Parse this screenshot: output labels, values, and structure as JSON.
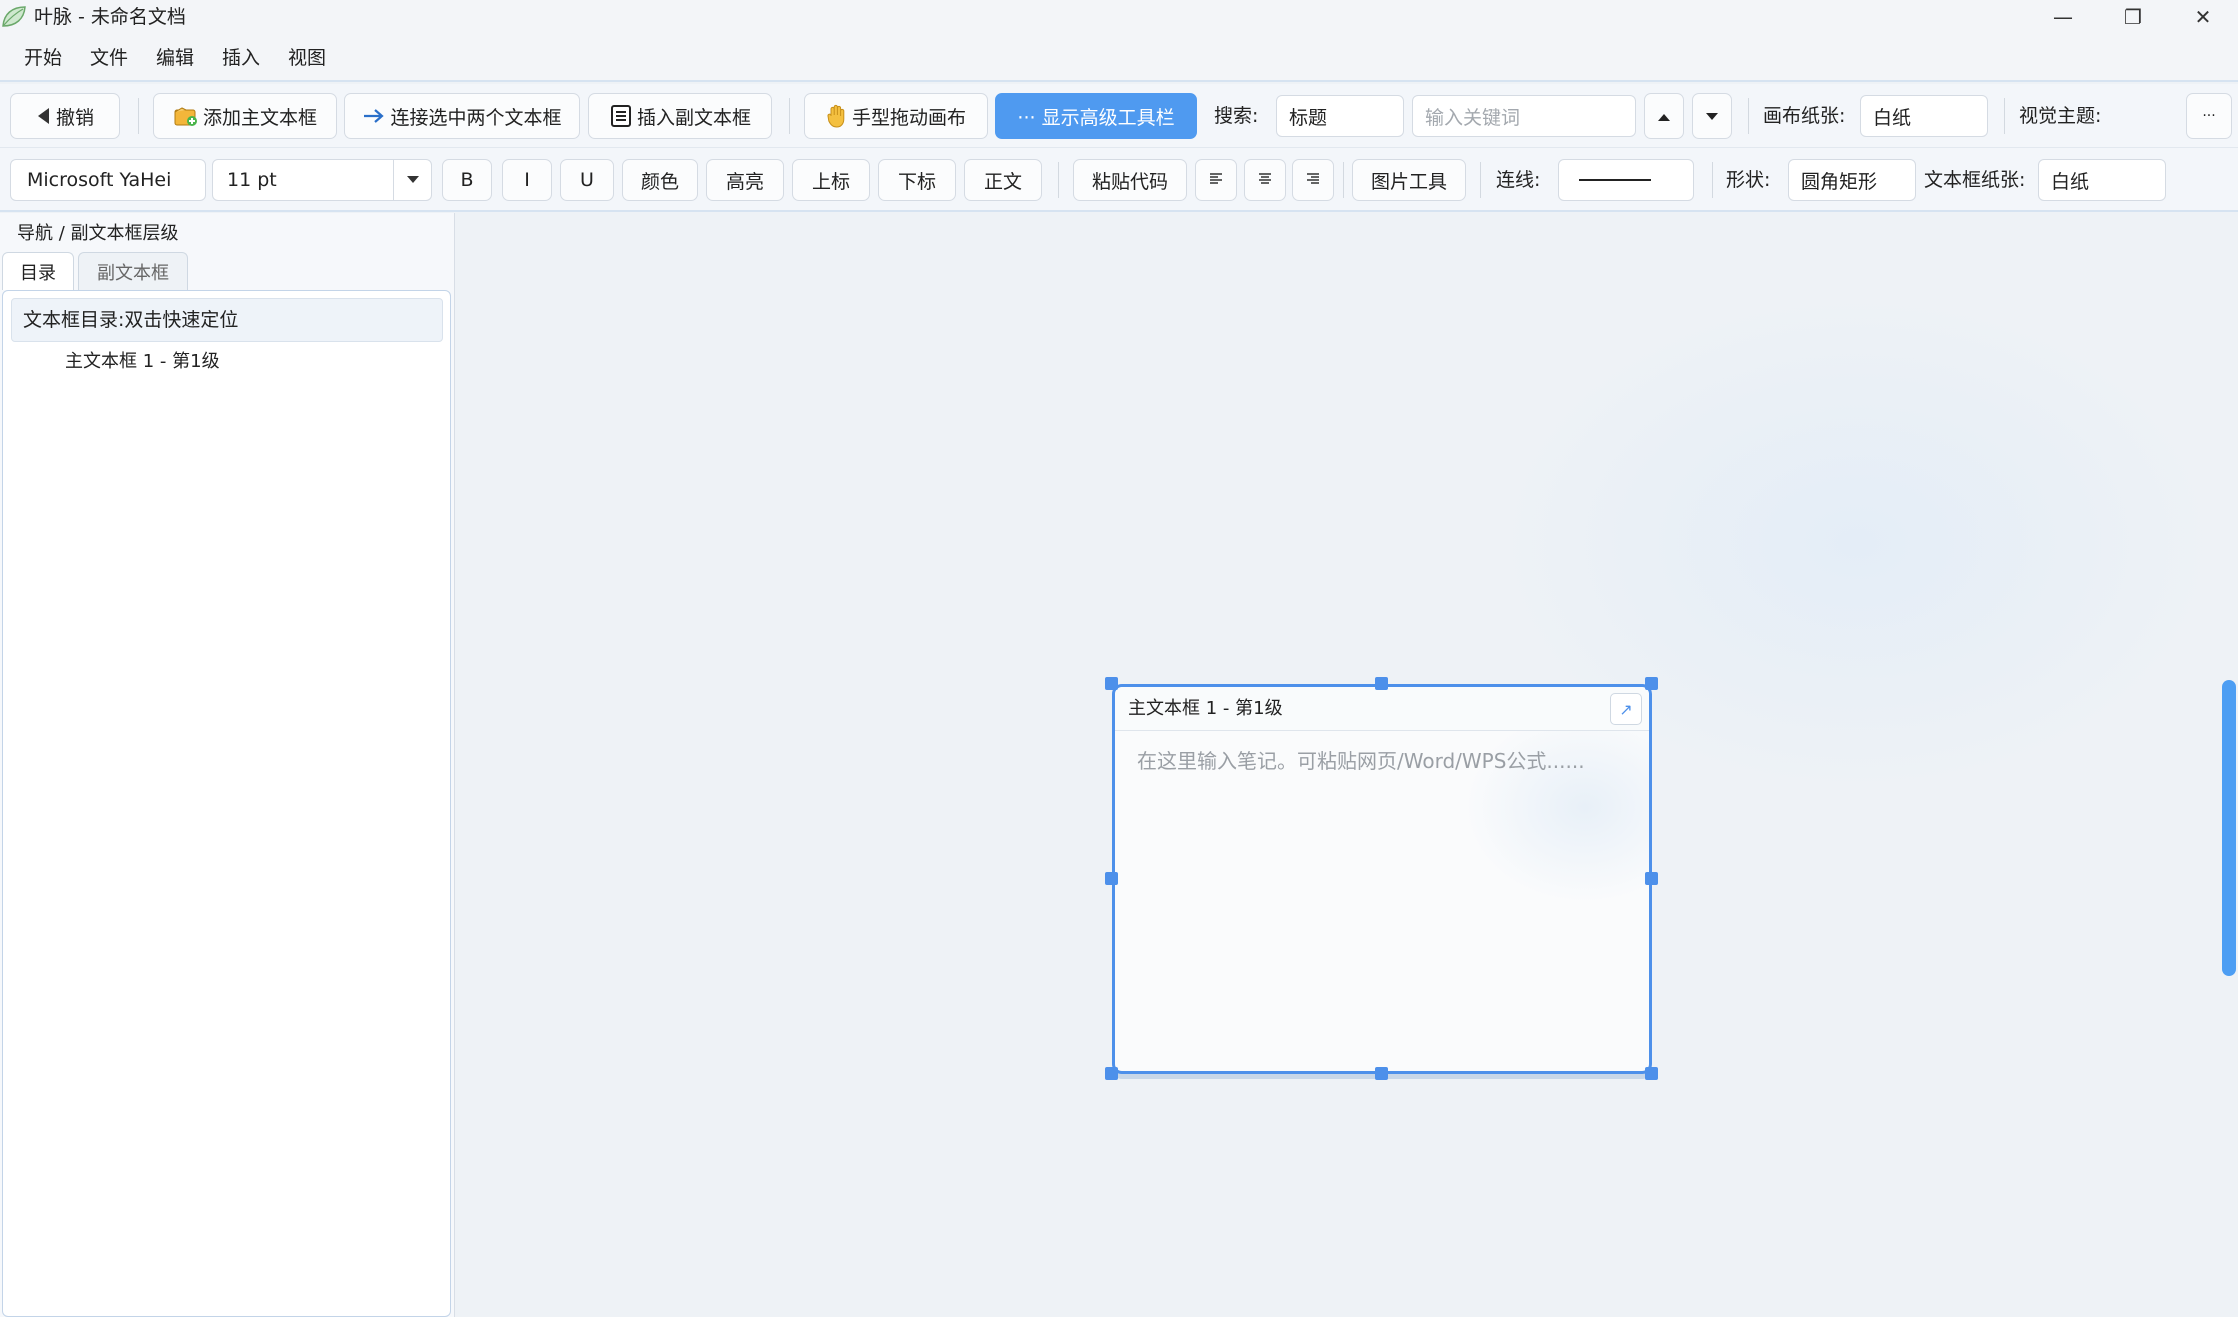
{
  "window": {
    "title": "叶脉 - 未命名文档",
    "minimize_label": "—",
    "restore_label": "❐",
    "close_label": "✕"
  },
  "menu": [
    "开始",
    "文件",
    "编辑",
    "插入",
    "视图"
  ],
  "toolbar1": {
    "undo": "撤销",
    "add_main_box": "添加主文本框",
    "connect_boxes": "连接选中两个文本框",
    "insert_sub_box": "插入副文本框",
    "hand_drag": "手型拖动画布",
    "show_advanced": "··· 显示高级工具栏",
    "search_label": "搜索:",
    "search_scope": "标题",
    "search_placeholder": "输入关键词",
    "canvas_paper_label": "画布纸张:",
    "canvas_paper_value": "白纸",
    "visual_theme_label": "视觉主题:",
    "more_label": "···"
  },
  "toolbar2": {
    "font_family": "Microsoft YaHei",
    "font_size": "11 pt",
    "bold": "B",
    "italic": "I",
    "underline": "U",
    "color": "颜色",
    "highlight": "高亮",
    "superscript": "上标",
    "subscript": "下标",
    "body_text": "正文",
    "paste_code": "粘贴代码",
    "image_tools": "图片工具",
    "line_label": "连线:",
    "shape_label": "形状:",
    "shape_value": "圆角矩形",
    "box_paper_label": "文本框纸张:",
    "box_paper_value": "白纸"
  },
  "left_panel": {
    "title": "导航 / 副文本框层级",
    "tabs": [
      "目录",
      "副文本框"
    ],
    "tree_header": "文本框目录:双击快速定位",
    "items": [
      "主文本框 1 - 第1级"
    ]
  },
  "note": {
    "title": "主文本框 1 - 第1级",
    "placeholder": "在这里输入笔记。可粘贴网页/Word/WPS公式......"
  },
  "colors": {
    "accent": "#4f9af0",
    "selection": "#4d90ea"
  }
}
